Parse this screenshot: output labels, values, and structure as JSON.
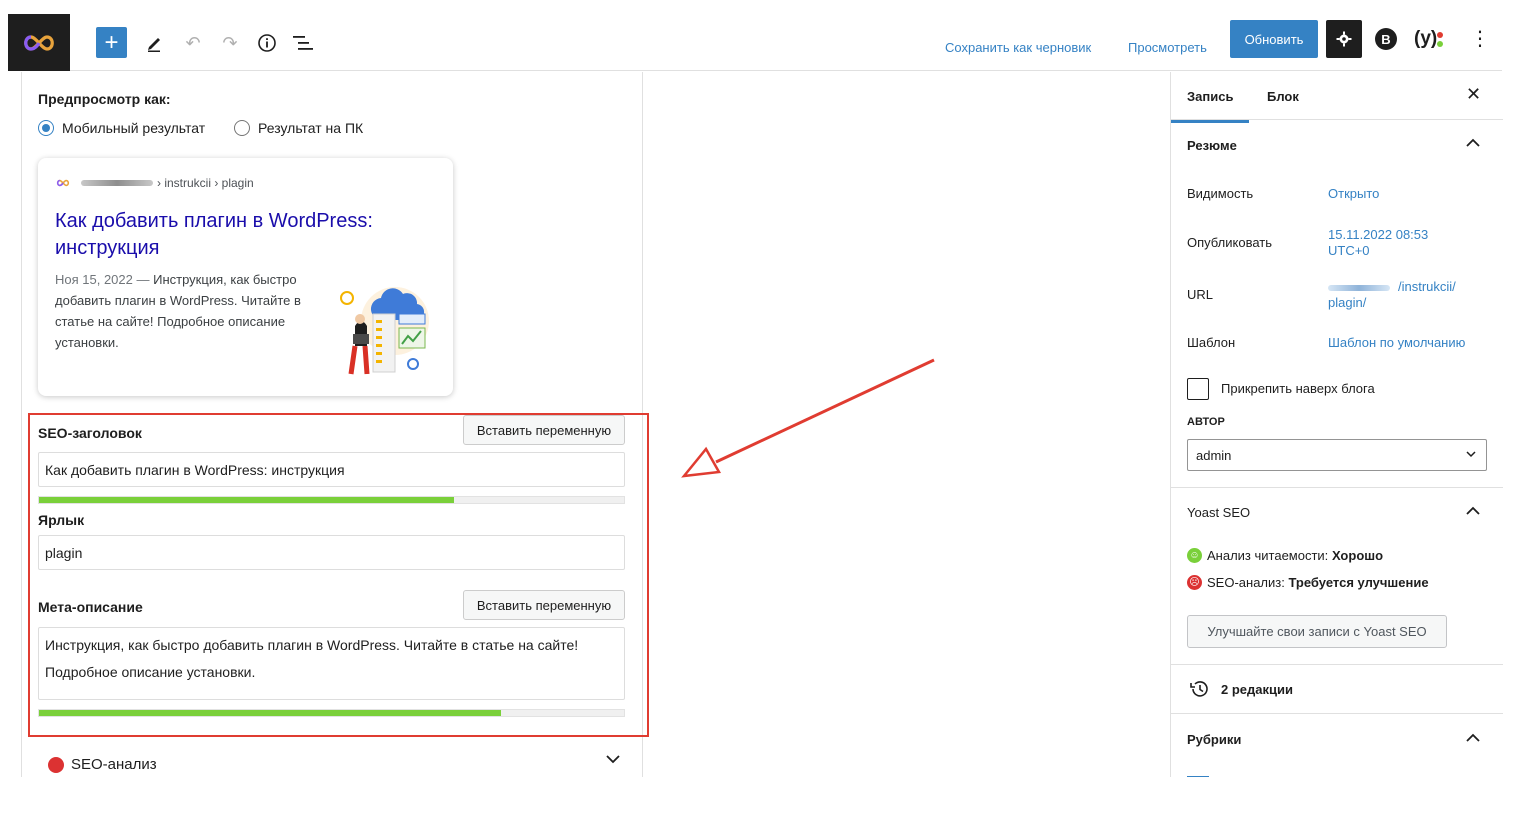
{
  "toolbar": {
    "save_draft": "Сохранить как черновик",
    "preview": "Просмотреть",
    "update": "Обновить"
  },
  "meta_panel": {
    "preview_as": "Предпросмотр как:",
    "radio_mobile": "Мобильный результат",
    "radio_desktop": "Результат на ПК",
    "serp": {
      "breadcrumb": "› instrukcii › plagin",
      "title": "Как добавить плагин в WordPress: инструкция",
      "date": "Ноя 15, 2022 —",
      "description": "Инструкция, как быстро добавить плагин в WordPress. Читайте в статье на сайте! Подробное описание установки."
    },
    "seo_title_label": "SEO-заголовок",
    "insert_variable": "Вставить переменную",
    "seo_title_value": "Как добавить плагин в WordPress: инструкция",
    "seo_title_progress": 0.71,
    "slug_label": "Ярлык",
    "slug_value": "plagin",
    "meta_desc_label": "Мета-описание",
    "meta_desc_value": "Инструкция, как быстро добавить плагин в WordPress. Читайте в статье на сайте! Подробное описание установки.",
    "meta_desc_progress": 0.79,
    "seo_analysis_label": "SEO-анализ"
  },
  "sidebar": {
    "tab_post": "Запись",
    "tab_block": "Блок",
    "summary_title": "Резюме",
    "visibility_label": "Видимость",
    "visibility_value": "Открыто",
    "publish_label": "Опубликовать",
    "publish_value_1": "15.11.2022 08:53",
    "publish_value_2": "UTC+0",
    "url_label": "URL",
    "url_value_1": "/instrukcii/",
    "url_value_2": "plagin/",
    "template_label": "Шаблон",
    "template_value": "Шаблон по умолчанию",
    "sticky_label": "Прикрепить наверх блога",
    "author_label": "АВТОР",
    "author_value": "admin",
    "yoast_title": "Yoast SEO",
    "readability_prefix": "Анализ читаемости:",
    "readability_value": "Хорошо",
    "seo_prefix": "SEO-анализ:",
    "seo_value": "Требуется улучшение",
    "yoast_button": "Улучшайте свои записи с Yoast SEO",
    "revisions": "2 редакции",
    "categories_title": "Рубрики"
  },
  "colors": {
    "accent": "#3582c4",
    "good": "#7ad03a",
    "bad": "#dc3232",
    "highlight": "#e03c31"
  },
  "icons": [
    "logo-icon",
    "plus-icon",
    "pencil-icon",
    "undo-icon",
    "redo-icon",
    "info-icon",
    "list-view-icon",
    "gear-icon",
    "plugin-badge-icon",
    "yoast-icon",
    "kebab-icon",
    "close-icon",
    "chevron-up-icon",
    "chevron-down-icon",
    "history-icon"
  ]
}
